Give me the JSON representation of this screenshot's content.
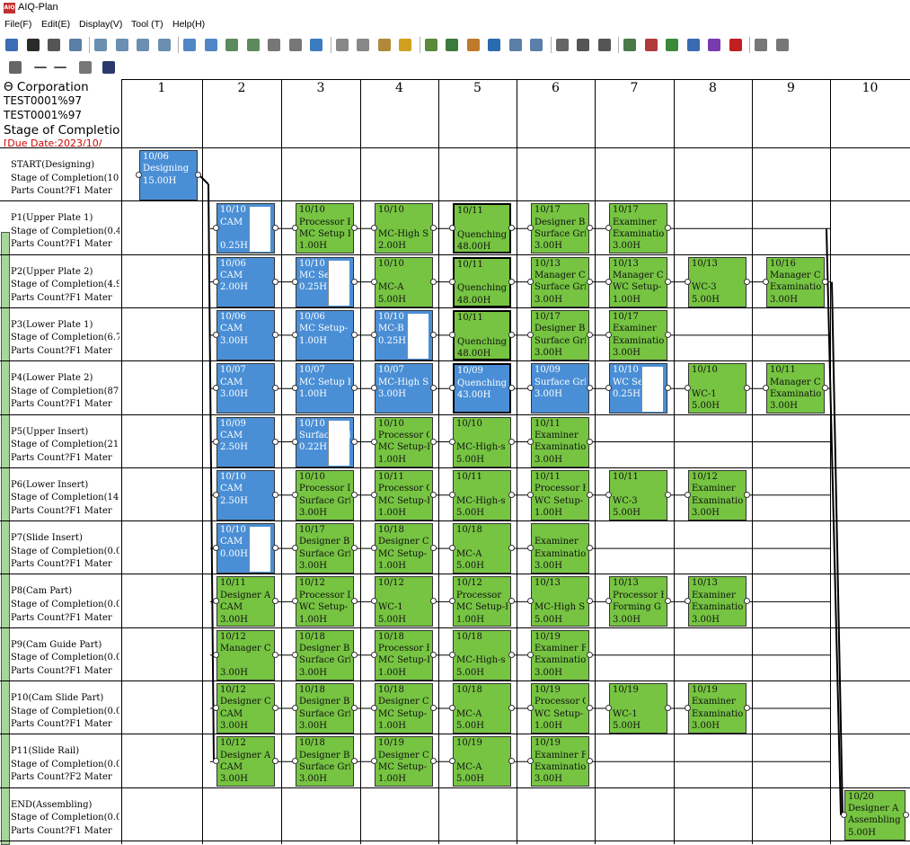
{
  "window": {
    "title": "AIQ-Plan",
    "icon": "aiq-plan-icon"
  },
  "menu": [
    {
      "label": "File(F)"
    },
    {
      "label": "Edit(E)"
    },
    {
      "label": "Display(V)"
    },
    {
      "label": "Tool (T)"
    },
    {
      "label": "Help(H)"
    }
  ],
  "toolbar_icons": [
    "new-icon",
    "save-icon",
    "hand-icon",
    "calculator-icon",
    "tool-icon",
    "tool-icon",
    "tool-icon",
    "tool-icon",
    "add-icon",
    "remove-icon",
    "link-icon",
    "link-icon",
    "align-icon",
    "align-icon",
    "refresh-icon",
    "settings-icon",
    "settings-icon",
    "settings-icon",
    "key-icon",
    "grid-icon",
    "chart-icon",
    "person-icon",
    "filter-icon",
    "sort-icon",
    "graph-icon",
    "window-icon",
    "window-icon",
    "window-icon",
    "globe-icon",
    "bar-chart-icon",
    "report-icon",
    "report-icon",
    "export-icon",
    "traffic-light-icon",
    "book-icon",
    "book-icon"
  ],
  "toolbar2_icons": [
    "save-icon",
    "arrow-icon",
    "arrow-icon",
    "wrench-icon",
    "binoculars-icon"
  ],
  "header": {
    "corporation": "Θ Corporation",
    "line2": "TEST0001%97",
    "line3": "TEST0001%97",
    "line4": " Stage of Completion",
    "due_date": "[Due Date:2023/10/"
  },
  "columns": [
    "1",
    "2",
    "3",
    "4",
    "5",
    "6",
    "7",
    "8",
    "9",
    "10"
  ],
  "rows": [
    {
      "name": "START(Designing)",
      "stage": "Stage of Completion(10",
      "parts": "Parts Count?F1  Mater"
    },
    {
      "name": "P1(Upper Plate 1)",
      "stage": "Stage of Completion(0.4",
      "parts": "Parts Count?F1  Mater"
    },
    {
      "name": "P2(Upper Plate 2)",
      "stage": "Stage of Completion(4.9",
      "parts": "Parts Count?F1  Mater"
    },
    {
      "name": "P3(Lower Plate 1)",
      "stage": "Stage of Completion(6.7",
      "parts": "Parts Count?F1  Mater"
    },
    {
      "name": "P4(Lower Plate 2)",
      "stage": "Stage of Completion(87",
      "parts": "Parts Count?F1  Mater"
    },
    {
      "name": "P5(Upper Insert)",
      "stage": "Stage of Completion(21",
      "parts": "Parts Count?F1  Mater"
    },
    {
      "name": "P6(Lower Insert)",
      "stage": "Stage of Completion(14",
      "parts": "Parts Count?F1  Mater"
    },
    {
      "name": "P7(Slide Insert)",
      "stage": "Stage of Completion(0.0",
      "parts": "Parts Count?F1  Mater"
    },
    {
      "name": "P8(Cam Part)",
      "stage": "Stage of Completion(0.0",
      "parts": "Parts Count?F1  Mater"
    },
    {
      "name": "P9(Cam Guide Part)",
      "stage": "Stage of Completion(0.0",
      "parts": "Parts Count?F1  Mater"
    },
    {
      "name": "P10(Cam Slide Part)",
      "stage": "Stage of Completion(0.0",
      "parts": "Parts Count?F1  Mater"
    },
    {
      "name": "P11(Slide Rail)",
      "stage": "Stage of Completion(0.0",
      "parts": "Parts Count?F2  Mater"
    },
    {
      "name": "END(Assembling)",
      "stage": "Stage of Completion(0.0",
      "parts": "Parts Count?F1  Mater"
    }
  ],
  "tasks": [
    {
      "row": 0,
      "col": 0,
      "color": "blue",
      "lines": [
        "10/06",
        "Designing",
        "15.00H"
      ],
      "progress": 1.0
    },
    {
      "row": 1,
      "col": 1,
      "color": "blue",
      "lines": [
        "10/10",
        "CAM",
        "",
        "0.25H"
      ],
      "progress": 0.55
    },
    {
      "row": 1,
      "col": 2,
      "color": "green",
      "lines": [
        "10/10",
        "Processor B",
        "MC Setup F",
        "1.00H"
      ]
    },
    {
      "row": 1,
      "col": 3,
      "color": "green",
      "lines": [
        "10/10",
        "",
        "MC-High S",
        "2.00H"
      ]
    },
    {
      "row": 1,
      "col": 4,
      "color": "green",
      "lines": [
        "10/11",
        "",
        "Quenching",
        "48.00H"
      ],
      "bold": true
    },
    {
      "row": 1,
      "col": 5,
      "color": "green",
      "lines": [
        "10/17",
        "Designer B",
        "Surface Gri",
        "3.00H"
      ]
    },
    {
      "row": 1,
      "col": 6,
      "color": "green",
      "lines": [
        "10/17",
        "Examiner",
        "Examinatio",
        "3.00H"
      ]
    },
    {
      "row": 2,
      "col": 1,
      "color": "blue",
      "lines": [
        "10/06",
        "CAM",
        "2.00H"
      ]
    },
    {
      "row": 2,
      "col": 2,
      "color": "blue",
      "lines": [
        "10/10",
        "MC Setup-",
        "0.25H"
      ],
      "progress": 0.55
    },
    {
      "row": 2,
      "col": 3,
      "color": "green",
      "lines": [
        "10/10",
        "",
        "MC-A",
        "5.00H"
      ]
    },
    {
      "row": 2,
      "col": 4,
      "color": "green",
      "lines": [
        "10/11",
        "",
        "Quenching",
        "48.00H"
      ],
      "bold": true
    },
    {
      "row": 2,
      "col": 5,
      "color": "green",
      "lines": [
        "10/13",
        "Manager C",
        "Surface Gri",
        "3.00H"
      ]
    },
    {
      "row": 2,
      "col": 6,
      "color": "green",
      "lines": [
        "10/13",
        "Manager C",
        "WC Setup-",
        "1.00H"
      ]
    },
    {
      "row": 2,
      "col": 7,
      "color": "green",
      "lines": [
        "10/13",
        "",
        "WC-3",
        "5.00H"
      ]
    },
    {
      "row": 2,
      "col": 8,
      "color": "green",
      "lines": [
        "10/16",
        "Manager C",
        "Examinatio",
        "3.00H"
      ]
    },
    {
      "row": 3,
      "col": 1,
      "color": "blue",
      "lines": [
        "10/06",
        "CAM",
        "3.00H"
      ]
    },
    {
      "row": 3,
      "col": 2,
      "color": "blue",
      "lines": [
        "10/06",
        "MC Setup-",
        "1.00H"
      ]
    },
    {
      "row": 3,
      "col": 3,
      "color": "blue",
      "lines": [
        "10/10",
        "MC-B",
        "0.25H"
      ],
      "progress": 0.55
    },
    {
      "row": 3,
      "col": 4,
      "color": "green",
      "lines": [
        "10/11",
        "",
        "Quenching",
        "48.00H"
      ],
      "bold": true
    },
    {
      "row": 3,
      "col": 5,
      "color": "green",
      "lines": [
        "10/17",
        "Designer B",
        "Surface Gri",
        "3.00H"
      ]
    },
    {
      "row": 3,
      "col": 6,
      "color": "green",
      "lines": [
        "10/17",
        "Examiner",
        "Examinatio",
        "3.00H"
      ]
    },
    {
      "row": 4,
      "col": 1,
      "color": "blue",
      "lines": [
        "10/07",
        "CAM",
        "3.00H"
      ]
    },
    {
      "row": 4,
      "col": 2,
      "color": "blue",
      "lines": [
        "10/07",
        "MC Setup F",
        "1.00H"
      ]
    },
    {
      "row": 4,
      "col": 3,
      "color": "blue",
      "lines": [
        "10/07",
        "MC-High S",
        "3.00H"
      ]
    },
    {
      "row": 4,
      "col": 4,
      "color": "blue",
      "lines": [
        "10/09",
        "Quenching",
        "43.00H"
      ],
      "bold": true
    },
    {
      "row": 4,
      "col": 5,
      "color": "blue",
      "lines": [
        "10/09",
        "Surface Gri",
        "3.00H"
      ]
    },
    {
      "row": 4,
      "col": 6,
      "color": "blue",
      "lines": [
        "10/10",
        "WC Setup-",
        "0.25H"
      ],
      "progress": 0.55
    },
    {
      "row": 4,
      "col": 7,
      "color": "green",
      "lines": [
        "10/10",
        "",
        "WC-1",
        "5.00H"
      ]
    },
    {
      "row": 4,
      "col": 8,
      "color": "green",
      "lines": [
        "10/11",
        "Manager C",
        "Examinatio",
        "3.00H"
      ]
    },
    {
      "row": 5,
      "col": 1,
      "color": "blue",
      "lines": [
        "10/09",
        "CAM",
        "2.50H"
      ]
    },
    {
      "row": 5,
      "col": 2,
      "color": "blue",
      "lines": [
        "10/10",
        "Surface Gri",
        "0.22H"
      ],
      "progress": 0.55
    },
    {
      "row": 5,
      "col": 3,
      "color": "green",
      "lines": [
        "10/10",
        "Processor C",
        "MC Setup-F",
        "1.00H"
      ]
    },
    {
      "row": 5,
      "col": 4,
      "color": "green",
      "lines": [
        "10/10",
        "",
        "MC-High-s",
        "5.00H"
      ]
    },
    {
      "row": 5,
      "col": 5,
      "color": "green",
      "lines": [
        "10/11",
        "Examiner",
        "Examinatio",
        "3.00H"
      ]
    },
    {
      "row": 6,
      "col": 1,
      "color": "blue",
      "lines": [
        "10/10",
        "CAM",
        "2.50H"
      ]
    },
    {
      "row": 6,
      "col": 2,
      "color": "green",
      "lines": [
        "10/10",
        "Processor D",
        "Surface Gri",
        "3.00H"
      ]
    },
    {
      "row": 6,
      "col": 3,
      "color": "green",
      "lines": [
        "10/11",
        "Processor C",
        "MC Setup-F",
        "1.00H"
      ]
    },
    {
      "row": 6,
      "col": 4,
      "color": "green",
      "lines": [
        "10/11",
        "",
        "MC-High-s",
        "5.00H"
      ]
    },
    {
      "row": 6,
      "col": 5,
      "color": "green",
      "lines": [
        "10/11",
        "Processor F",
        "WC Setup-",
        "1.00H"
      ]
    },
    {
      "row": 6,
      "col": 6,
      "color": "green",
      "lines": [
        "10/11",
        "",
        "WC-3",
        "5.00H"
      ]
    },
    {
      "row": 6,
      "col": 7,
      "color": "green",
      "lines": [
        "10/12",
        "Examiner",
        "Examinatio",
        "3.00H"
      ]
    },
    {
      "row": 7,
      "col": 1,
      "color": "blue",
      "lines": [
        "10/10",
        "CAM",
        "0.00H"
      ],
      "progress": 0.55
    },
    {
      "row": 7,
      "col": 2,
      "color": "green",
      "lines": [
        "10/17",
        "Designer B",
        "Surface Gri",
        "3.00H"
      ]
    },
    {
      "row": 7,
      "col": 3,
      "color": "green",
      "lines": [
        "10/18",
        "Designer C",
        "MC Setup-",
        "1.00H"
      ]
    },
    {
      "row": 7,
      "col": 4,
      "color": "green",
      "lines": [
        "10/18",
        "",
        "MC-A",
        "5.00H"
      ]
    },
    {
      "row": 7,
      "col": 5,
      "color": "green",
      "lines": [
        "",
        "Examiner",
        "Examinatio",
        "3.00H"
      ]
    },
    {
      "row": 8,
      "col": 1,
      "color": "green",
      "lines": [
        "10/11",
        "Designer A",
        "CAM",
        "3.00H"
      ]
    },
    {
      "row": 8,
      "col": 2,
      "color": "green",
      "lines": [
        "10/12",
        "Processor D",
        "WC Setup-",
        "1.00H"
      ]
    },
    {
      "row": 8,
      "col": 3,
      "color": "green",
      "lines": [
        "10/12",
        "",
        "WC-1",
        "5.00H"
      ]
    },
    {
      "row": 8,
      "col": 4,
      "color": "green",
      "lines": [
        "10/12",
        "Processor",
        "MC Setup-F",
        "1.00H"
      ]
    },
    {
      "row": 8,
      "col": 5,
      "color": "green",
      "lines": [
        "10/13",
        "",
        "MC-High S",
        "5.00H"
      ]
    },
    {
      "row": 8,
      "col": 6,
      "color": "green",
      "lines": [
        "10/13",
        "Processor F",
        "Forming G",
        "3.00H"
      ]
    },
    {
      "row": 8,
      "col": 7,
      "color": "green",
      "lines": [
        "10/13",
        "Examiner",
        "Examinatio",
        "3.00H"
      ]
    },
    {
      "row": 9,
      "col": 1,
      "color": "green",
      "lines": [
        "10/12",
        "Manager C",
        "",
        "3.00H"
      ]
    },
    {
      "row": 9,
      "col": 2,
      "color": "green",
      "lines": [
        "10/18",
        "Designer B",
        "Surface Gri",
        "3.00H"
      ]
    },
    {
      "row": 9,
      "col": 3,
      "color": "green",
      "lines": [
        "10/18",
        "Processor B",
        "MC Setup-F",
        "1.00H"
      ]
    },
    {
      "row": 9,
      "col": 4,
      "color": "green",
      "lines": [
        "10/18",
        "",
        "MC-High-s",
        "5.00H"
      ]
    },
    {
      "row": 9,
      "col": 5,
      "color": "green",
      "lines": [
        "10/19",
        "Examiner F",
        "Examinatio",
        "3.00H"
      ]
    },
    {
      "row": 10,
      "col": 1,
      "color": "green",
      "lines": [
        "10/12",
        "Designer C",
        "CAM",
        "3.00H"
      ]
    },
    {
      "row": 10,
      "col": 2,
      "color": "green",
      "lines": [
        "10/18",
        "Designer B",
        "Surface Gri",
        "3.00H"
      ]
    },
    {
      "row": 10,
      "col": 3,
      "color": "green",
      "lines": [
        "10/18",
        "Designer C",
        "MC Setup-",
        "1.00H"
      ]
    },
    {
      "row": 10,
      "col": 4,
      "color": "green",
      "lines": [
        "10/18",
        "",
        "MC-A",
        "5.00H"
      ]
    },
    {
      "row": 10,
      "col": 5,
      "color": "green",
      "lines": [
        "10/19",
        "Processor C",
        "WC Setup-",
        "1.00H"
      ]
    },
    {
      "row": 10,
      "col": 6,
      "color": "green",
      "lines": [
        "10/19",
        "",
        "WC-1",
        "5.00H"
      ]
    },
    {
      "row": 10,
      "col": 7,
      "color": "green",
      "lines": [
        "10/19",
        "Examiner",
        "Examinatio",
        "3.00H"
      ]
    },
    {
      "row": 11,
      "col": 1,
      "color": "green",
      "lines": [
        "10/12",
        "Designer A",
        "CAM",
        "3.00H"
      ]
    },
    {
      "row": 11,
      "col": 2,
      "color": "green",
      "lines": [
        "10/18",
        "Designer B",
        "Surface Gri",
        "3.00H"
      ]
    },
    {
      "row": 11,
      "col": 3,
      "color": "green",
      "lines": [
        "10/19",
        "Designer C",
        "MC Setup-",
        "1.00H"
      ]
    },
    {
      "row": 11,
      "col": 4,
      "color": "green",
      "lines": [
        "10/19",
        "",
        "MC-A",
        "5.00H"
      ]
    },
    {
      "row": 11,
      "col": 5,
      "color": "green",
      "lines": [
        "10/19",
        "Examiner F",
        "Examinatio",
        "3.00H"
      ]
    },
    {
      "row": 12,
      "col": 9,
      "color": "green",
      "lines": [
        "10/20",
        "Designer A",
        "Assembling",
        "5.00H"
      ]
    }
  ],
  "colors": {
    "task_green": "#76c442",
    "task_blue": "#4a8fd6",
    "due_date": "#d00000"
  }
}
